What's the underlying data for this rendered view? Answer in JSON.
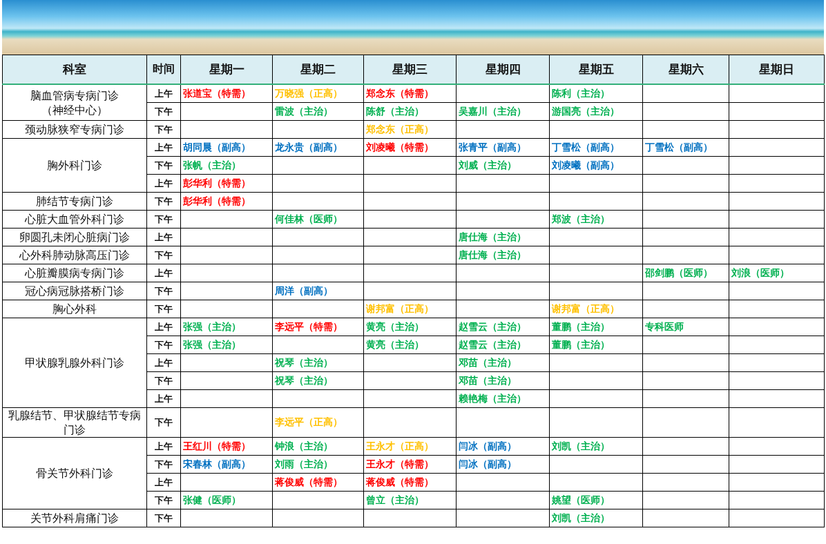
{
  "table": {
    "columns": [
      "科室",
      "时间",
      "星期一",
      "星期二",
      "星期三",
      "星期四",
      "星期五",
      "星期六",
      "星期日"
    ],
    "departments": [
      {
        "name": "脑血管病专病门诊",
        "subname": "（神经中心）",
        "sessions": [
          {
            "time": "上午",
            "cells": [
              {
                "text": "张道宝（特需）",
                "color": "#ff0000"
              },
              {
                "text": "万晓强（正高）",
                "color": "#ffc000"
              },
              {
                "text": "郑念东（特需）",
                "color": "#ff0000"
              },
              null,
              {
                "text": "陈利（主治）",
                "color": "#00b050"
              },
              null,
              null
            ]
          },
          {
            "time": "下午",
            "cells": [
              null,
              {
                "text": "雷波（主治）",
                "color": "#00b050"
              },
              {
                "text": "陈舒（主治）",
                "color": "#00b050"
              },
              {
                "text": "吴嘉川（主治）",
                "color": "#00b050"
              },
              {
                "text": "游国亮（主治）",
                "color": "#00b050"
              },
              null,
              null
            ]
          }
        ]
      },
      {
        "name": "颈动脉狭窄专病门诊",
        "sessions": [
          {
            "time": "下午",
            "cells": [
              null,
              null,
              {
                "text": "郑念东（正高）",
                "color": "#ffc000"
              },
              null,
              null,
              null,
              null
            ]
          }
        ]
      },
      {
        "name": "胸外科门诊",
        "sessions": [
          {
            "time": "上午",
            "cells": [
              {
                "text": "胡同晨（副高）",
                "color": "#0070c0"
              },
              {
                "text": "龙永贵（副高）",
                "color": "#0070c0"
              },
              {
                "text": "刘凌曦（特需）",
                "color": "#ff0000"
              },
              {
                "text": "张青平（副高）",
                "color": "#0070c0"
              },
              {
                "text": "丁雪松（副高）",
                "color": "#0070c0"
              },
              {
                "text": "丁雪松（副高）",
                "color": "#0070c0"
              },
              null
            ]
          },
          {
            "time": "下午",
            "cells": [
              {
                "text": "张帆（主治）",
                "color": "#00b050"
              },
              null,
              null,
              {
                "text": "刘威（主治）",
                "color": "#00b050"
              },
              {
                "text": "刘凌曦（副高）",
                "color": "#0070c0"
              },
              null,
              null
            ]
          },
          {
            "time": "上午",
            "cells": [
              {
                "text": "彭华利（特需）",
                "color": "#ff0000"
              },
              null,
              null,
              null,
              null,
              null,
              null
            ]
          }
        ]
      },
      {
        "name": "肺结节专病门诊",
        "sessions": [
          {
            "time": "下午",
            "cells": [
              {
                "text": "彭华利（特需）",
                "color": "#ff0000"
              },
              null,
              null,
              null,
              null,
              null,
              null
            ]
          }
        ]
      },
      {
        "name": "心脏大血管外科门诊",
        "sessions": [
          {
            "time": "下午",
            "cells": [
              null,
              {
                "text": "何佳林（医师）",
                "color": "#00b050"
              },
              null,
              null,
              {
                "text": "郑波（主治）",
                "color": "#00b050"
              },
              null,
              null
            ]
          }
        ]
      },
      {
        "name": "卵圆孔未闭心脏病门诊",
        "sessions": [
          {
            "time": "上午",
            "cells": [
              null,
              null,
              null,
              {
                "text": "唐仕海（主治）",
                "color": "#00b050"
              },
              null,
              null,
              null
            ]
          }
        ]
      },
      {
        "name": "心外科肺动脉高压门诊",
        "sessions": [
          {
            "time": "下午",
            "cells": [
              null,
              null,
              null,
              {
                "text": "唐仕海（主治）",
                "color": "#00b050"
              },
              null,
              null,
              null
            ]
          }
        ]
      },
      {
        "name": "心脏瓣膜病专病门诊",
        "sessions": [
          {
            "time": "上午",
            "cells": [
              null,
              null,
              null,
              null,
              null,
              {
                "text": "邵剑鹏（医师）",
                "color": "#00b050"
              },
              {
                "text": "刘浪（医师）",
                "color": "#00b050"
              }
            ]
          }
        ]
      },
      {
        "name": "冠心病冠脉搭桥门诊",
        "sessions": [
          {
            "time": "下午",
            "cells": [
              null,
              {
                "text": "周洋（副高）",
                "color": "#0070c0"
              },
              null,
              null,
              null,
              null,
              null
            ]
          }
        ]
      },
      {
        "name": "胸心外科",
        "sessions": [
          {
            "time": "下午",
            "cells": [
              null,
              null,
              {
                "text": "谢邦富（正高）",
                "color": "#ffc000"
              },
              null,
              {
                "text": "谢邦富（正高）",
                "color": "#ffc000"
              },
              null,
              null
            ]
          }
        ]
      },
      {
        "name": "甲状腺乳腺外科门诊",
        "sessions": [
          {
            "time": "上午",
            "cells": [
              {
                "text": "张强（主治）",
                "color": "#00b050"
              },
              {
                "text": "李远平（特需）",
                "color": "#ff0000"
              },
              {
                "text": "黄亮（主治）",
                "color": "#00b050"
              },
              {
                "text": "赵雪云（主治）",
                "color": "#00b050"
              },
              {
                "text": "董鹏（主治）",
                "color": "#00b050"
              },
              {
                "text": "专科医师",
                "color": "#00b050"
              },
              null
            ]
          },
          {
            "time": "下午",
            "cells": [
              {
                "text": "张强（主治）",
                "color": "#00b050"
              },
              null,
              {
                "text": "黄亮（主治）",
                "color": "#00b050"
              },
              {
                "text": "赵雪云（主治）",
                "color": "#00b050"
              },
              {
                "text": "董鹏（主治）",
                "color": "#00b050"
              },
              null,
              null
            ]
          },
          {
            "time": "上午",
            "cells": [
              null,
              {
                "text": "祝琴（主治）",
                "color": "#00b050"
              },
              null,
              {
                "text": "邓苗（主治）",
                "color": "#00b050"
              },
              null,
              null,
              null
            ]
          },
          {
            "time": "下午",
            "cells": [
              null,
              {
                "text": "祝琴（主治）",
                "color": "#00b050"
              },
              null,
              {
                "text": "邓苗（主治）",
                "color": "#00b050"
              },
              null,
              null,
              null
            ]
          },
          {
            "time": "上午",
            "cells": [
              null,
              null,
              null,
              {
                "text": "赖艳梅（主治）",
                "color": "#00b050"
              },
              null,
              null,
              null
            ]
          }
        ]
      },
      {
        "name": "乳腺结节、甲状腺结节专病门诊",
        "sessions": [
          {
            "time": "下午",
            "cells": [
              null,
              {
                "text": "李远平（正高）",
                "color": "#ffc000"
              },
              null,
              null,
              null,
              null,
              null
            ]
          }
        ]
      },
      {
        "name": "骨关节外科门诊",
        "sessions": [
          {
            "time": "上午",
            "cells": [
              {
                "text": "王红川（特需）",
                "color": "#ff0000"
              },
              {
                "text": "钟浪（主治）",
                "color": "#00b050"
              },
              {
                "text": "王永才（正高）",
                "color": "#ffc000"
              },
              {
                "text": "闫冰（副高）",
                "color": "#0070c0"
              },
              {
                "text": "刘凯（主治）",
                "color": "#00b050"
              },
              null,
              null
            ]
          },
          {
            "time": "下午",
            "cells": [
              {
                "text": "宋春林（副高）",
                "color": "#0070c0"
              },
              {
                "text": "刘雨（主治）",
                "color": "#00b050"
              },
              {
                "text": "王永才（特需）",
                "color": "#ff0000"
              },
              {
                "text": "闫冰（副高）",
                "color": "#0070c0"
              },
              null,
              null,
              null
            ]
          },
          {
            "time": "上午",
            "cells": [
              null,
              {
                "text": "蒋俊威（特需）",
                "color": "#ff0000"
              },
              {
                "text": "蒋俊威（特需）",
                "color": "#ff0000"
              },
              null,
              null,
              null,
              null
            ]
          },
          {
            "time": "下午",
            "cells": [
              {
                "text": "张健（医师）",
                "color": "#00b050"
              },
              null,
              {
                "text": "曾立（主治）",
                "color": "#00b050"
              },
              null,
              {
                "text": "姚望（医师）",
                "color": "#00b050"
              },
              null,
              null
            ]
          }
        ]
      },
      {
        "name": "关节外科肩痛门诊",
        "sessions": [
          {
            "time": "下午",
            "cells": [
              null,
              null,
              null,
              null,
              {
                "text": "刘凯（主治）",
                "color": "#00b050"
              },
              null,
              null
            ]
          }
        ]
      }
    ]
  }
}
